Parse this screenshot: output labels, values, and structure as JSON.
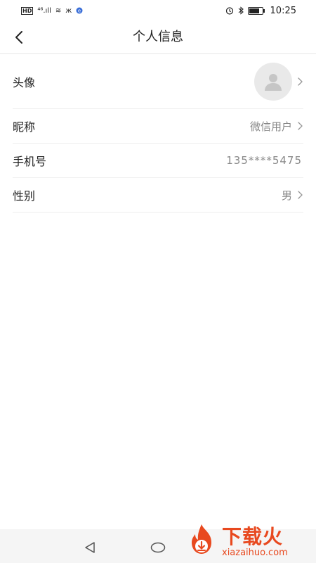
{
  "status_bar": {
    "network_hd": "HD",
    "signal": "⁴⁶.ıll",
    "wifi_glyph": "≋",
    "mute_glyph": "ж",
    "time": "10:25",
    "battery_level": 0.8
  },
  "nav": {
    "title": "个人信息",
    "back_icon": "chevron-left-icon"
  },
  "profile": {
    "avatar_label": "头像",
    "nickname_label": "昵称",
    "nickname_value": "微信用户",
    "phone_label": "手机号",
    "phone_value": "135****5475",
    "gender_label": "性别",
    "gender_value": "男"
  },
  "watermark": {
    "brand_cn": "下载火",
    "brand_en": "xiazaihuo.com",
    "color": "#e8491f"
  }
}
